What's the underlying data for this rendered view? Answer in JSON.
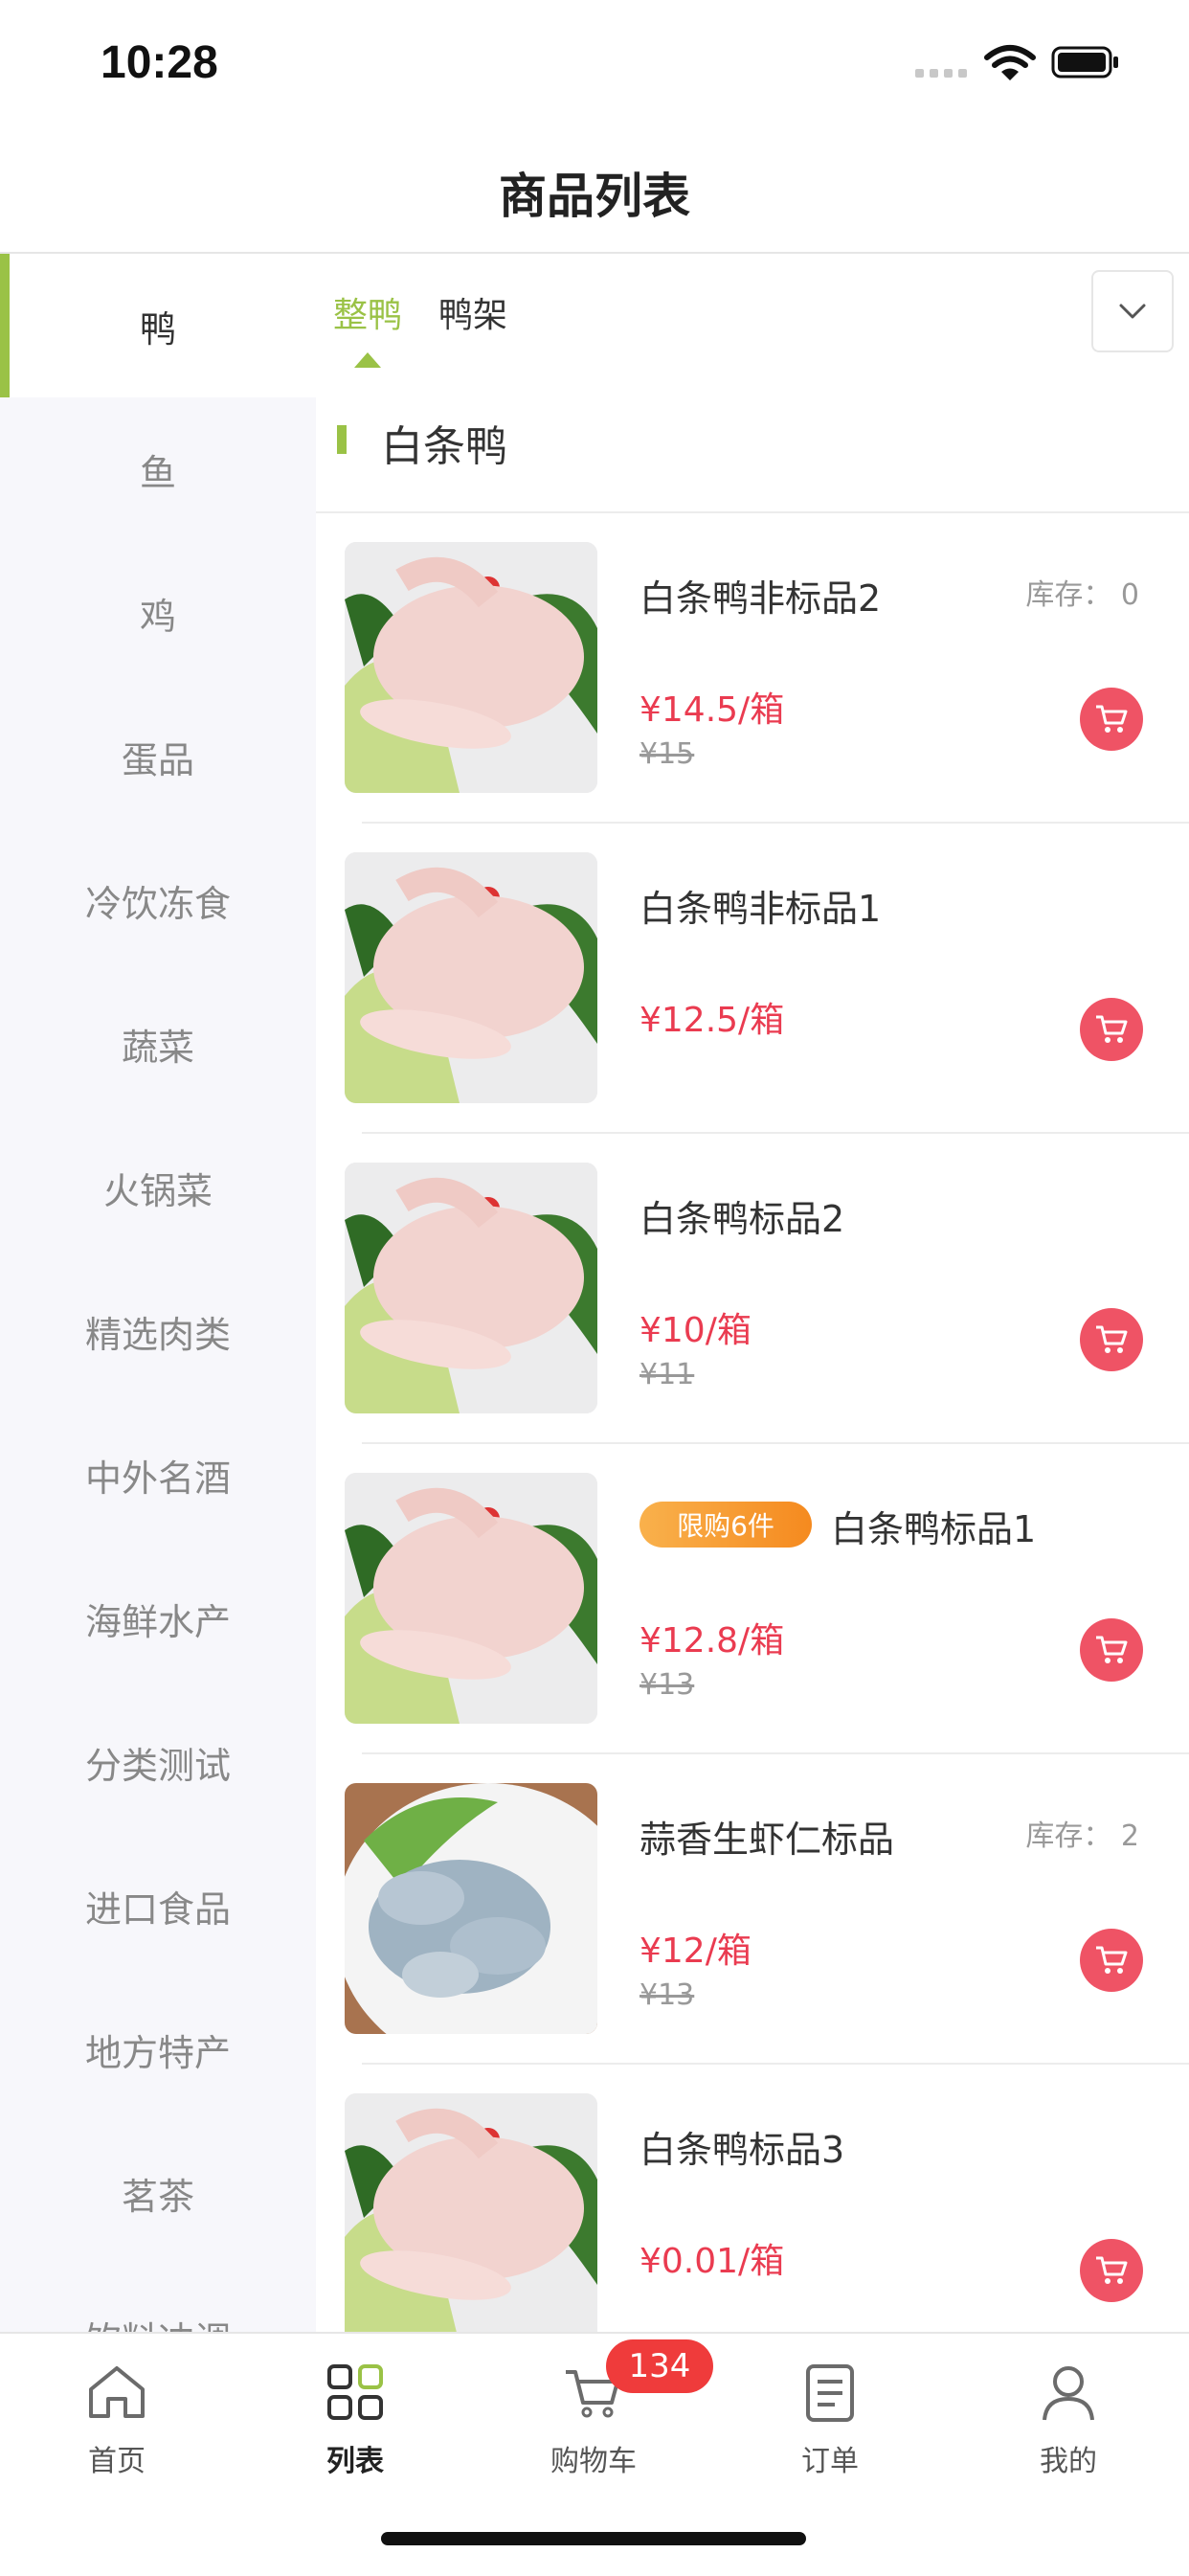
{
  "status_bar": {
    "time": "10:28"
  },
  "header": {
    "title": "商品列表"
  },
  "sidebar": {
    "items": [
      {
        "label": "鸭",
        "active": true
      },
      {
        "label": "鱼"
      },
      {
        "label": "鸡"
      },
      {
        "label": "蛋品"
      },
      {
        "label": "冷饮冻食"
      },
      {
        "label": "蔬菜"
      },
      {
        "label": "火锅菜"
      },
      {
        "label": "精选肉类"
      },
      {
        "label": "中外名酒"
      },
      {
        "label": "海鲜水产"
      },
      {
        "label": "分类测试"
      },
      {
        "label": "进口食品"
      },
      {
        "label": "地方特产"
      },
      {
        "label": "茗茶"
      },
      {
        "label": "饮料冲调"
      }
    ]
  },
  "tabs": [
    {
      "label": "整鸭",
      "active": true
    },
    {
      "label": "鸭架"
    }
  ],
  "section": {
    "title": "白条鸭"
  },
  "products": [
    {
      "name": "白条鸭非标品2",
      "stock": "库存： 0",
      "price": "¥14.5/箱",
      "original_price": "¥15",
      "image": "duck"
    },
    {
      "name": "白条鸭非标品1",
      "price": "¥12.5/箱",
      "image": "duck"
    },
    {
      "name": "白条鸭标品2",
      "price": "¥10/箱",
      "original_price": "¥11",
      "image": "duck"
    },
    {
      "name": "白条鸭标品1",
      "badge": "限购6件",
      "price": "¥12.8/箱",
      "original_price": "¥13",
      "image": "duck"
    },
    {
      "name": "蒜香生虾仁标品",
      "stock": "库存： 2",
      "price": "¥12/箱",
      "original_price": "¥13",
      "image": "shrimp"
    },
    {
      "name": "白条鸭标品3",
      "price": "¥0.01/箱",
      "image": "duck"
    }
  ],
  "bottom_nav": {
    "items": [
      {
        "label": "首页",
        "icon": "home-icon"
      },
      {
        "label": "列表",
        "icon": "grid-icon",
        "active": true
      },
      {
        "label": "购物车",
        "icon": "cart-icon"
      },
      {
        "label": "订单",
        "icon": "order-icon"
      },
      {
        "label": "我的",
        "icon": "user-icon"
      }
    ],
    "cart_badge": "134"
  },
  "colors": {
    "accent": "#9ac246",
    "price": "#ea3b50",
    "cart_button": "#ef5365",
    "badge": "#ef3b3b"
  }
}
